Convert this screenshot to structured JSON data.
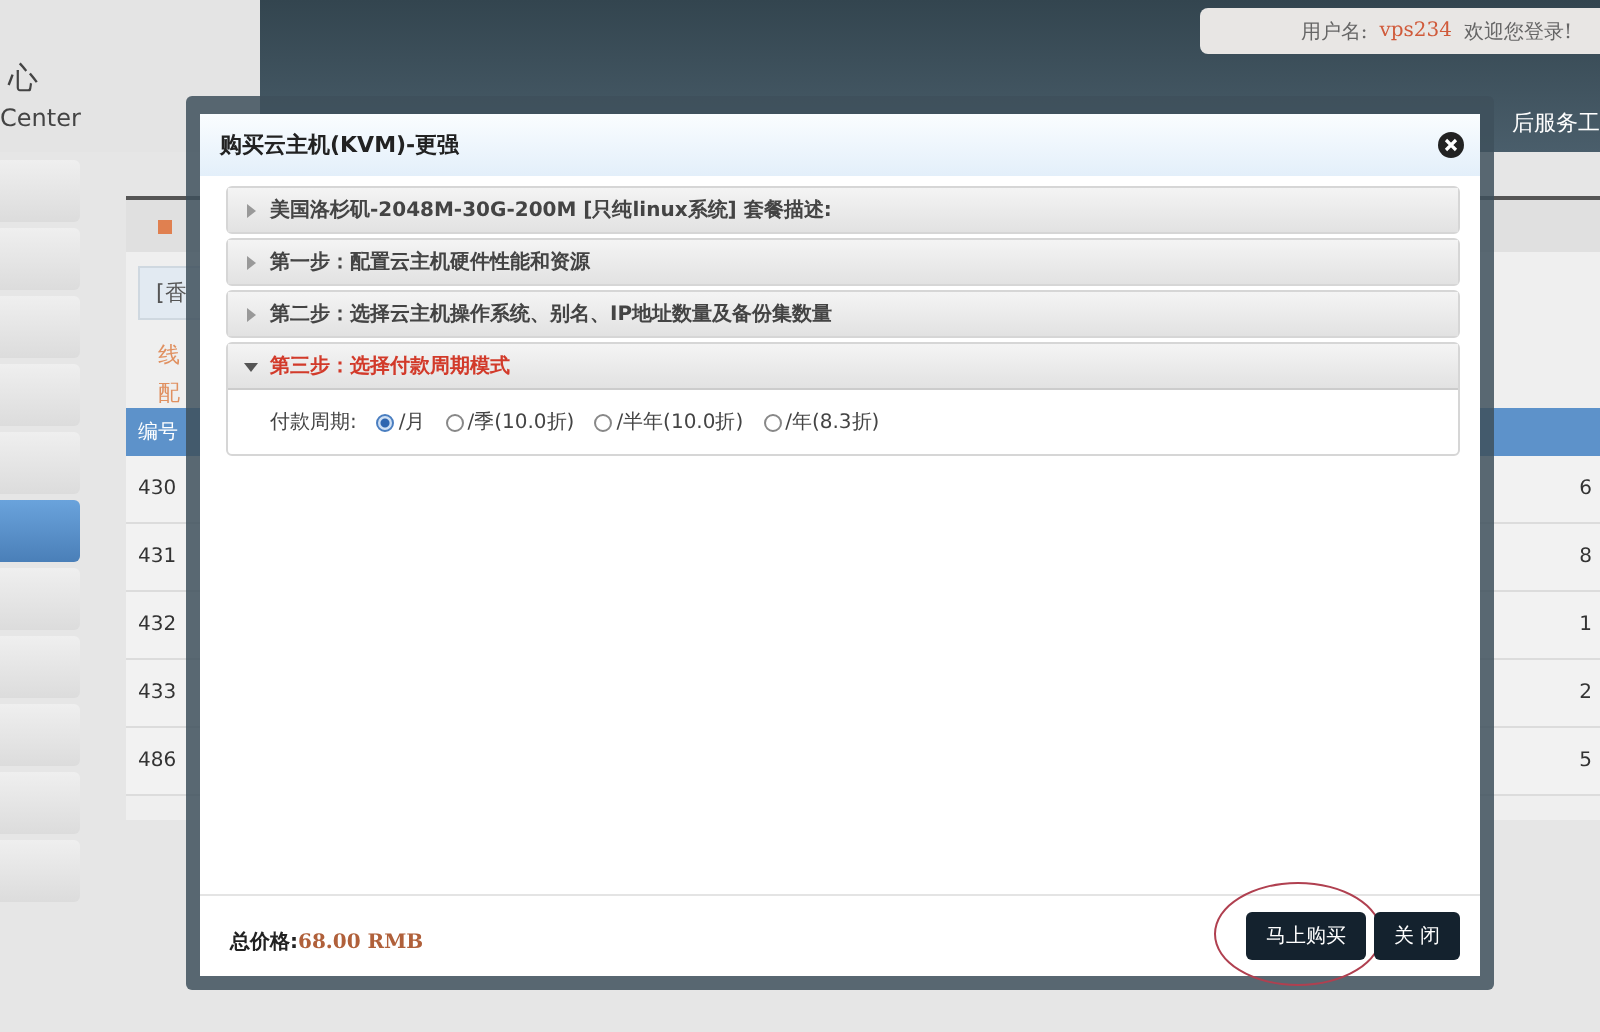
{
  "header": {
    "logo_lines": [
      "心",
      "Center"
    ],
    "user_label": "用户名:",
    "username": "vps234",
    "welcome": "欢迎您登录!",
    "nav_text": "后服务工"
  },
  "sidebar": {
    "items": [
      {
        "selected": false
      },
      {
        "selected": false
      },
      {
        "selected": false
      },
      {
        "selected": false
      },
      {
        "selected": false
      },
      {
        "selected": true
      },
      {
        "selected": false
      },
      {
        "selected": false
      },
      {
        "selected": false
      },
      {
        "selected": false
      },
      {
        "selected": false
      }
    ]
  },
  "panel": {
    "filter_text": "[香",
    "notes": [
      "线",
      "配"
    ],
    "table": {
      "columns": [
        "编号"
      ],
      "rows": [
        {
          "id": "430",
          "column_2": "6"
        },
        {
          "id": "431",
          "column_2": "8"
        },
        {
          "id": "432",
          "column_2": "1"
        },
        {
          "id": "433",
          "column_2": "2"
        },
        {
          "id": "486",
          "column_2": "5"
        }
      ]
    }
  },
  "dialog": {
    "title": "购买云主机(KVM)-更强",
    "sections": [
      {
        "title": "美国洛杉矶-2048M-30G-200M [只纯linux系统] 套餐描述:",
        "expanded": false
      },
      {
        "title": "第一步：配置云主机硬件性能和资源",
        "expanded": false
      },
      {
        "title": "第二步：选择云主机操作系统、别名、IP地址数量及备份集数量",
        "expanded": false
      },
      {
        "title": "第三步：选择付款周期模式",
        "expanded": true
      }
    ],
    "payment": {
      "label": "付款周期:",
      "options": [
        {
          "label": "/月",
          "selected": true
        },
        {
          "label": "/季(10.0折)",
          "selected": false
        },
        {
          "label": "/半年(10.0折)",
          "selected": false
        },
        {
          "label": "/年(8.3折)",
          "selected": false
        }
      ]
    },
    "total_label": "总价格:",
    "total": "68.00 RMB",
    "buttons": [
      {
        "label": "马上购买",
        "highlighted": true
      },
      {
        "label": "关 闭",
        "highlighted": false
      }
    ]
  }
}
